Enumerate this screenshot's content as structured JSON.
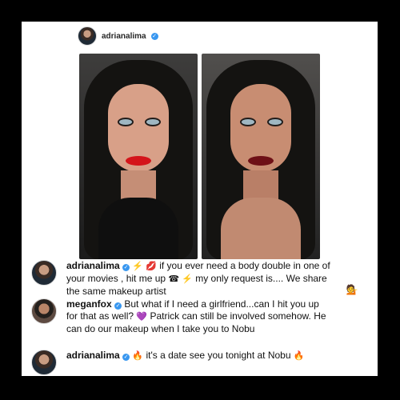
{
  "header": {
    "username": "adrianalima",
    "verified_icon": "verified-badge-icon"
  },
  "images": [
    {
      "label": "Adriana Lima portrait"
    },
    {
      "label": "Megan Fox portrait"
    }
  ],
  "comments": [
    {
      "avatar": "adriana-avatar",
      "username": "adrianalima",
      "verified_icon": "verified-badge-icon",
      "emojis_1": "⚡ 💋",
      "text_1": "if you ever need a body double in one of your movies , hit me up",
      "emojis_2": "☎ ⚡",
      "text_2": "my only request is.... We share the same makeup artist",
      "emoji_3": "💁"
    },
    {
      "avatar": "megan-avatar",
      "username": "meganfox",
      "verified_icon": "verified-badge-icon",
      "text": "But what if I need a girlfriend...can I hit you up for that as well?",
      "emoji": "💜",
      "text_2": "Patrick can still be involved somehow. He can do our makeup when I take you to Nobu"
    },
    {
      "avatar": "adriana-avatar",
      "username": "adrianalima",
      "verified_icon": "verified-badge-icon",
      "emoji_1": "🔥",
      "text": "it's a date see you tonight at Nobu",
      "emoji_2": "🔥"
    }
  ]
}
